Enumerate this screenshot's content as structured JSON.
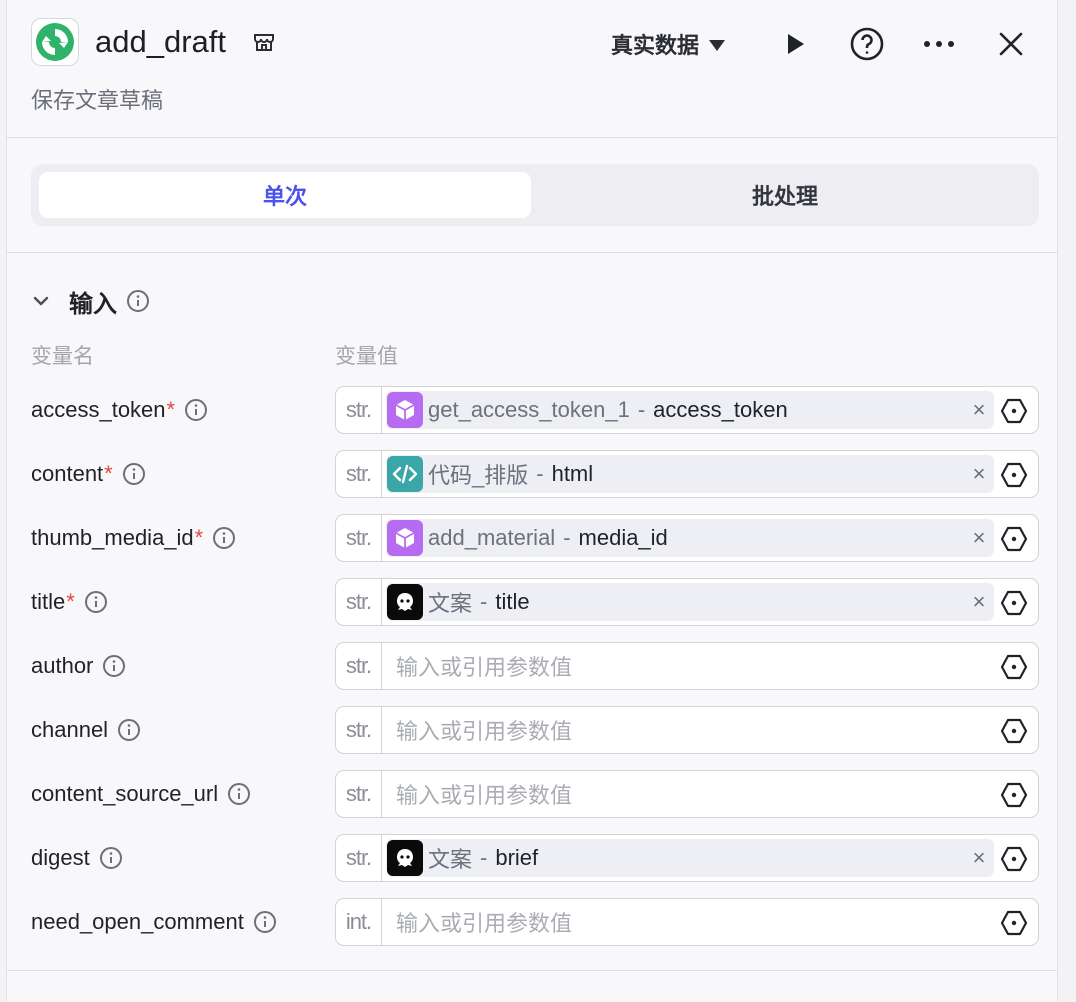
{
  "header": {
    "title": "add_draft",
    "subtitle": "保存文章草稿",
    "mode_label": "真实数据"
  },
  "tabs": [
    {
      "label": "单次",
      "active": true
    },
    {
      "label": "批处理",
      "active": false
    }
  ],
  "inputs": {
    "section_title": "输入",
    "col_name": "变量名",
    "col_value": "变量值",
    "rows": [
      {
        "name": "access_token",
        "required": "*",
        "type": "str.",
        "source": "get_access_token_1",
        "sep": "-",
        "variable": "access_token",
        "icon": "cube-icon",
        "icon_color": "#b56cf0"
      },
      {
        "name": "content",
        "required": "*",
        "type": "str.",
        "source": "代码_排版",
        "sep": "-",
        "variable": "html",
        "icon": "code-icon",
        "icon_color": "#3ba6a8"
      },
      {
        "name": "thumb_media_id",
        "required": "*",
        "type": "str.",
        "source": "add_material",
        "sep": "-",
        "variable": "media_id",
        "icon": "cube-icon",
        "icon_color": "#b56cf0"
      },
      {
        "name": "title",
        "required": "*",
        "type": "str.",
        "source": "文案",
        "sep": "-",
        "variable": "title",
        "icon": "ghost-icon",
        "icon_color": "#0a0a0a"
      },
      {
        "name": "author",
        "type": "str.",
        "placeholder": "输入或引用参数值"
      },
      {
        "name": "channel",
        "type": "str.",
        "placeholder": "输入或引用参数值"
      },
      {
        "name": "content_source_url",
        "type": "str.",
        "placeholder": "输入或引用参数值"
      },
      {
        "name": "digest",
        "type": "str.",
        "source": "文案",
        "sep": "-",
        "variable": "brief",
        "icon": "ghost-icon",
        "icon_color": "#0a0a0a"
      },
      {
        "name": "need_open_comment",
        "type": "int.",
        "placeholder": "输入或引用参数值"
      }
    ]
  },
  "colors": {
    "accent": "#4d53e8",
    "required": "#e54545",
    "logo_green": "#2fb36b"
  }
}
